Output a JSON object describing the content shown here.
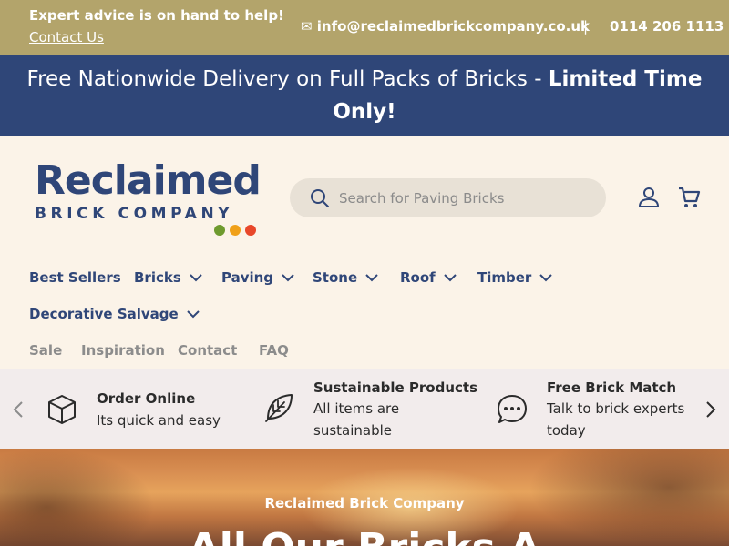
{
  "topbar": {
    "advice": "Expert advice is on hand to help!",
    "contact_link": "Contact Us",
    "email": "✉ info@reclaimedbrickcompany.co.uk",
    "separator": "|",
    "phone": "0114 206 1113"
  },
  "promo": {
    "text": "Free Nationwide Delivery on Full Packs of Bricks - ",
    "highlight": "Limited Time Only!"
  },
  "logo": {
    "line1": "Reclaimed",
    "line2": "BRICK COMPANY",
    "dot_colors": [
      "#6e9a2e",
      "#f0a018",
      "#e8472a"
    ]
  },
  "search": {
    "placeholder": "Search for Paving Bricks",
    "icon": "search-icon"
  },
  "header_icons": {
    "account": "user-icon",
    "cart": "cart-icon"
  },
  "nav": {
    "items": [
      {
        "label": "Best Sellers"
      },
      {
        "label": "Bricks"
      },
      {
        "label": "Paving"
      },
      {
        "label": "Stone"
      },
      {
        "label": "Roof"
      },
      {
        "label": "Timber"
      },
      {
        "label": "Decorative Salvage"
      }
    ],
    "subitems": [
      {
        "label": "Sale"
      },
      {
        "label": "Inspiration"
      },
      {
        "label": "Contact"
      },
      {
        "label": "FAQ"
      }
    ]
  },
  "features": [
    {
      "title": "Order Online",
      "text": "Its quick and easy",
      "icon": "box-icon"
    },
    {
      "title": "Sustainable Products",
      "text": "All items are sustainable",
      "icon": "leaf-icon"
    },
    {
      "title": "Free Brick Match",
      "text": "Talk to brick experts today",
      "icon": "chat-icon"
    }
  ],
  "hero": {
    "eyebrow": "Reclaimed Brick Company",
    "headline": "All Our Bricks A"
  },
  "colors": {
    "topbar": "#b3a46b",
    "promo": "#2f4678",
    "brand_blue": "#2f4678",
    "background": "#fbf3e8"
  }
}
